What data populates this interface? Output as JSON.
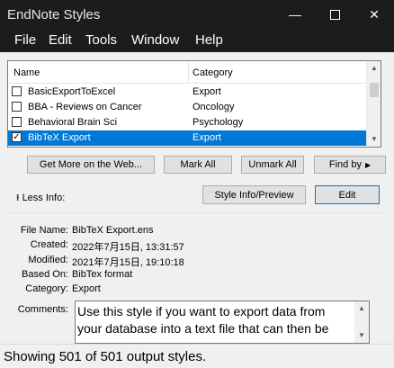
{
  "window": {
    "title": "EndNote Styles",
    "min_icon": "minimize-icon",
    "max_icon": "maximize-icon",
    "close_icon": "close-icon"
  },
  "menu": [
    "File",
    "Edit",
    "Tools",
    "Window",
    "Help"
  ],
  "list": {
    "header": {
      "name": "Name",
      "category": "Category"
    },
    "rows": [
      {
        "name": "BasicExportToExcel",
        "category": "Export",
        "checked": false,
        "selected": false
      },
      {
        "name": "BBA - Reviews on Cancer",
        "category": "Oncology",
        "checked": false,
        "selected": false
      },
      {
        "name": "Behavioral Brain Sci",
        "category": "Psychology",
        "checked": false,
        "selected": false
      },
      {
        "name": "BibTeX Export",
        "category": "Export",
        "checked": true,
        "selected": true
      }
    ]
  },
  "buttons": {
    "get_more": "Get More on the Web...",
    "mark_all": "Mark All",
    "unmark_all": "Unmark All",
    "find_by": "Find by",
    "style_info": "Style Info/Preview",
    "edit": "Edit"
  },
  "less_info": "Less Info:",
  "info": {
    "file_name_label": "File Name:",
    "file_name": "BibTeX Export.ens",
    "created_label": "Created:",
    "created": "2022年7月15日, 13:31:57",
    "modified_label": "Modified:",
    "modified": "2021年7月15日, 19:10:18",
    "based_on_label": "Based On:",
    "based_on": "BibTex format",
    "category_label": "Category:",
    "category": "Export",
    "comments_label": "Comments:",
    "comments": "Use this style if you want to export data from your database into a text file that can then be"
  },
  "status": "Showing 501 of 501 output styles.",
  "colors": {
    "selection": "#0078d7",
    "titlebar": "#1c1c1c"
  }
}
